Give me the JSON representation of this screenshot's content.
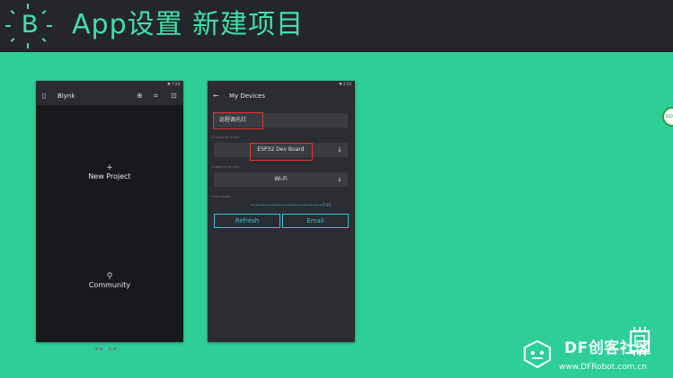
{
  "header": {
    "logo_letter": "B",
    "title": "App设置 新建项目"
  },
  "phone_left": {
    "status_time": "♥ 7:24",
    "app_title": "Blynk",
    "new_project": {
      "glyph": "+",
      "label": "New Project"
    },
    "community": {
      "glyph": "⚲",
      "label": "Community"
    },
    "page_dots": {
      "count": 5,
      "active": 3
    }
  },
  "phone_right": {
    "status_time": "♥ 2:24",
    "app_title": "My Devices",
    "project_name": "远程调光灯",
    "hardware_label": "HARDWARE MODEL",
    "hardware_value": "ESP32 Dev Board",
    "connection_label": "CONNECTION TYPE",
    "connection_value": "Wi-Fi",
    "token_label": "AUTH TOKEN",
    "token_value": "•••••••••••••••••••••••••••••••f736",
    "refresh_label": "Refresh",
    "email_label": "Email"
  },
  "side_badge": "GO",
  "watermark": {
    "brand": "DF创客社区",
    "url": "www.DFRobot.com.cn"
  },
  "colors": {
    "background": "#2ecf96",
    "header": "#24262b",
    "accent": "#41e0a8",
    "button": "#2fc4d8",
    "highlight": "#e3342f"
  }
}
